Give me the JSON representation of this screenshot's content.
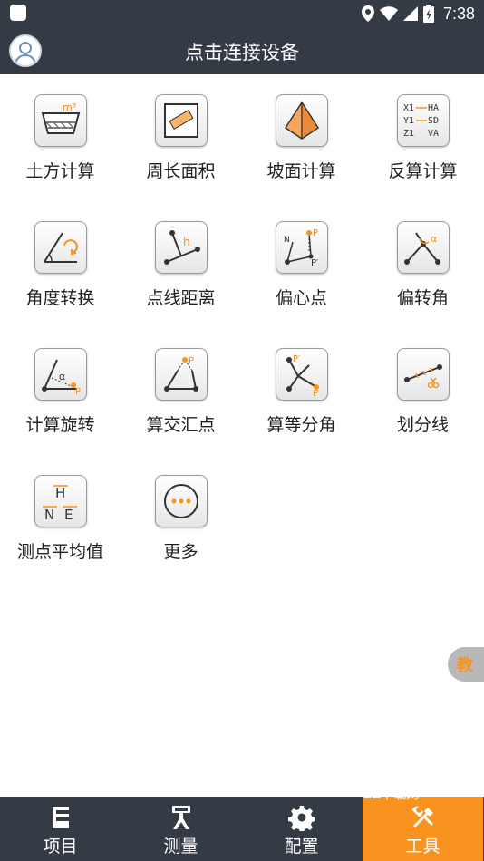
{
  "status": {
    "time": "7:38"
  },
  "header": {
    "title": "点击连接设备"
  },
  "tools": [
    {
      "label": "土方计算",
      "icon": "earthwork-icon",
      "icon_text": "m³"
    },
    {
      "label": "周长面积",
      "icon": "perimeter-area-icon"
    },
    {
      "label": "坡面计算",
      "icon": "slope-pyramid-icon"
    },
    {
      "label": "反算计算",
      "icon": "inverse-calc-icon",
      "icon_lines": [
        "X1 HA",
        "Y1 SD",
        "Z1 VA"
      ]
    },
    {
      "label": "角度转换",
      "icon": "angle-convert-icon"
    },
    {
      "label": "点线距离",
      "icon": "point-line-distance-icon",
      "icon_text": "h"
    },
    {
      "label": "偏心点",
      "icon": "eccentric-point-icon",
      "icon_text": "N P P′"
    },
    {
      "label": "偏转角",
      "icon": "deflection-angle-icon",
      "icon_text": "α"
    },
    {
      "label": "计算旋转",
      "icon": "rotation-calc-icon",
      "icon_text": "α P"
    },
    {
      "label": "算交汇点",
      "icon": "intersection-icon",
      "icon_text": "P"
    },
    {
      "label": "算等分角",
      "icon": "angle-bisector-icon",
      "icon_text": "P′ P"
    },
    {
      "label": "划分线",
      "icon": "divide-line-icon"
    },
    {
      "label": "测点平均值",
      "icon": "average-point-icon",
      "icon_text": "H N E"
    },
    {
      "label": "更多",
      "icon": "more-icon"
    }
  ],
  "side_tab": {
    "label": "教"
  },
  "bottom_nav": [
    {
      "label": "项目",
      "icon": "project-icon",
      "active": false
    },
    {
      "label": "测量",
      "icon": "survey-icon",
      "active": false
    },
    {
      "label": "配置",
      "icon": "settings-gear-icon",
      "active": false
    },
    {
      "label": "工具",
      "icon": "tools-icon",
      "active": true
    }
  ],
  "watermark": "ZZ下载网",
  "colors": {
    "bar": "#343b44",
    "accent": "#f7931e"
  }
}
